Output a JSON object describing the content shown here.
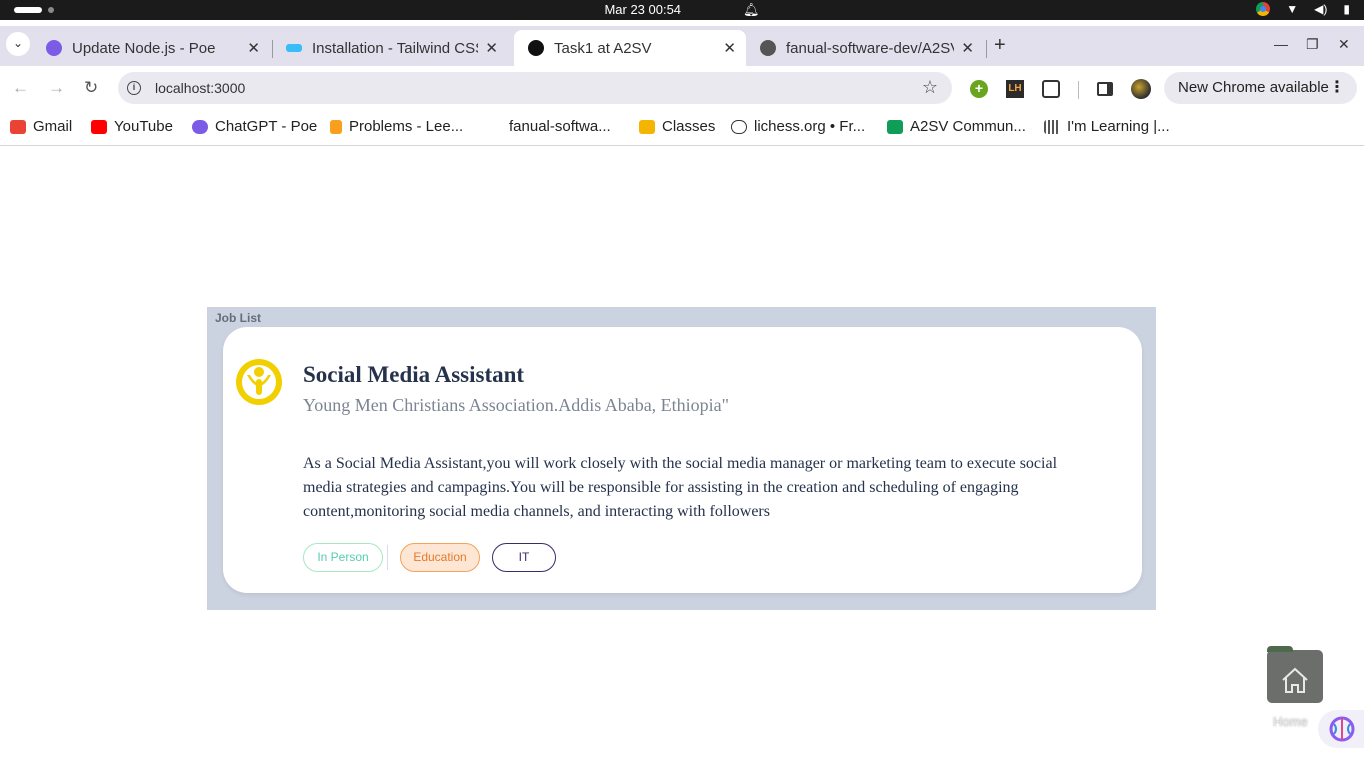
{
  "os": {
    "clock": "Mar 23  00:54"
  },
  "tabs": [
    {
      "title": "Update Node.js - Poe",
      "favicon": "poe-icon",
      "color": "#7c5ce6",
      "active": false
    },
    {
      "title": "Installation - Tailwind CSS",
      "favicon": "tailwind-icon",
      "color": "#38bdf8",
      "active": false
    },
    {
      "title": "Task1 at A2SV",
      "favicon": "nextjs-icon",
      "color": "#111111",
      "active": true
    },
    {
      "title": "fanual-software-dev/A2SV",
      "favicon": "github-icon",
      "color": "#555555",
      "active": false
    }
  ],
  "toolbar": {
    "url": "localhost:3000",
    "update_label": "New Chrome available"
  },
  "bookmarks": [
    {
      "label": "Gmail",
      "icon": "gmail-icon",
      "color": "#ea4335"
    },
    {
      "label": "YouTube",
      "icon": "youtube-icon",
      "color": "#ff0000"
    },
    {
      "label": "ChatGPT - Poe",
      "icon": "poe-icon",
      "color": "#7c5ce6"
    },
    {
      "label": "Problems - Lee...",
      "icon": "leetcode-icon",
      "color": "#f89f1b"
    },
    {
      "label": "fanual-softwa...",
      "icon": "github-icon",
      "color": "#ffffff"
    },
    {
      "label": "Classes",
      "icon": "classroom-icon",
      "color": "#f4b400"
    },
    {
      "label": "lichess.org • Fr...",
      "icon": "lichess-icon",
      "color": "#333333"
    },
    {
      "label": "A2SV Commun...",
      "icon": "sheets-icon",
      "color": "#0f9d58"
    },
    {
      "label": "I'm Learning |...",
      "icon": "learning-icon",
      "color": "#555555"
    }
  ],
  "main": {
    "heading": "Job List",
    "job": {
      "title": "Social Media Assistant",
      "company": "Young Men Christians Association.Addis Ababa, Ethiopia\"",
      "description": "As a Social Media Assistant,you will work closely with the social media manager or marketing team to execute social media strategies and campagins.You will be responsible for assisting in the creation and scheduling of engaging content,monitoring social media channels, and interacting with followers",
      "tags": [
        "In Person",
        "Education",
        "IT"
      ],
      "logo_icon": "ymca-logo-icon",
      "logo_color": "#f2d000"
    }
  },
  "desktop": {
    "home_label": "Home"
  }
}
